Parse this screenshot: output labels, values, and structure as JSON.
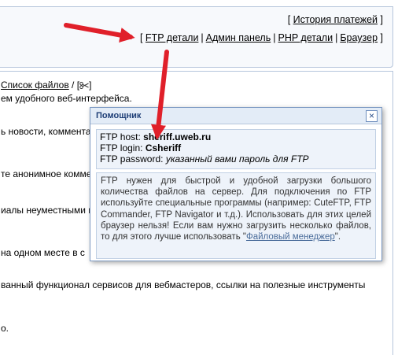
{
  "header": {
    "history_label": "История платежей",
    "nav_links": [
      "FTP детали",
      "Админ панель",
      "PHP детали",
      "Браузер"
    ]
  },
  "content": {
    "breadcrumb_label": "Список файлов",
    "breadcrumb_sep": "/",
    "line1": "ем удобного веб-интерфейса.",
    "line2": "ь новости, коммента",
    "line3": "те анонимное комме",
    "line4": "иалы неуместными и",
    "line5": "на одном месте в с",
    "line6": "ванный функционал сервисов для вебмастеров, ссылки на полезные инструменты",
    "line7": "о."
  },
  "helper": {
    "title": "Помощник",
    "close_icon": "×",
    "host_label": "FTP host:",
    "host_value": "sheriff.uweb.ru",
    "login_label": "FTP login:",
    "login_value": "Csheriff",
    "password_label": "FTP password:",
    "password_value": "указанный вами пароль для FTP",
    "desc_text": "FTP нужен для быстрой и удобной загрузки большого количества файлов на сервер. Для подключения по FTP используйте специальные программы (например: CuteFTP, FTP Commander, FTP Navigator и т.д.). Использовать для этих целей браузер нельзя! Если вам нужно загрузить несколько файлов, то для этого лучше использовать \"",
    "desc_link": "Файловый менеджер",
    "desc_end": "\"."
  },
  "colors": {
    "arrow": "#e0202a",
    "panel_border": "#b6c6dc",
    "popup_header": "#e3ecf7"
  }
}
